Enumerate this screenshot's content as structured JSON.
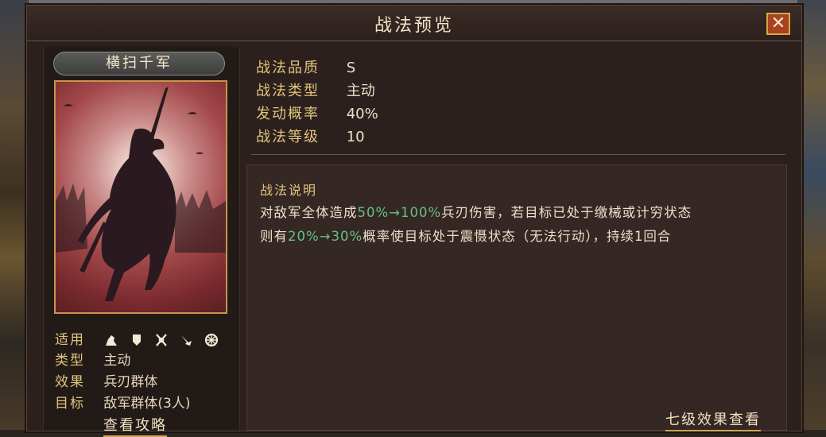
{
  "window": {
    "title": "战法预览",
    "close_label": "✕"
  },
  "skill": {
    "name": "横扫千军"
  },
  "meta": {
    "applicable_label": "适用",
    "applicable_icons": [
      "cavalry-icon",
      "shield-icon",
      "bow-icon",
      "spear-icon",
      "siege-icon"
    ],
    "type_label": "类型",
    "type_value": "主动",
    "effect_label": "效果",
    "effect_value": "兵刃群体",
    "target_label": "目标",
    "target_value": "敌军群体(3人)"
  },
  "guide_link": "查看攻略",
  "info": [
    {
      "key": "战法品质",
      "value": "S"
    },
    {
      "key": "战法类型",
      "value": "主动"
    },
    {
      "key": "发动概率",
      "value": "40%"
    },
    {
      "key": "战法等级",
      "value": "10"
    }
  ],
  "description": {
    "title": "战法说明",
    "line1": {
      "a": "对敌军全体造成",
      "hl1": "50%→100%",
      "b": "兵刃伤害，若目标已处于缴械或计穷状态"
    },
    "line2": {
      "a": "则有",
      "hl1": "20%→30%",
      "b": "概率使目标处于震慑状态（无法行动），持续1回合"
    }
  },
  "seven_level_link": "七级效果查看",
  "colors": {
    "accent_gold": "#e2c57c",
    "highlight_green": "#66c08a",
    "close_bg": "#a8431f"
  }
}
